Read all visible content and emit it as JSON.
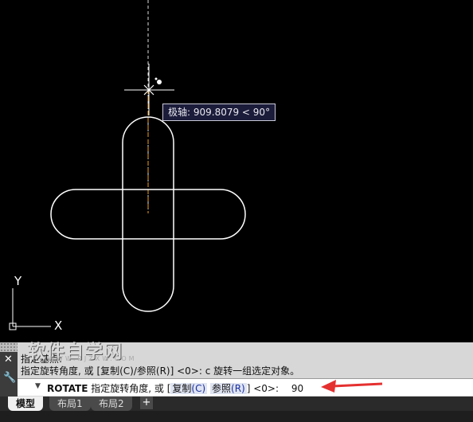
{
  "tooltip": {
    "text": "极轴: 909.8079 < 90°"
  },
  "ucs": {
    "y_label": "Y",
    "x_label": "X"
  },
  "watermark": {
    "text": "软件自学网",
    "sub": "WWW.RJZXW.COM"
  },
  "command_history": [
    "指定基点:",
    "指定旋转角度, 或 [复制(C)/参照(R)] <0>:  c 旋转一组选定对象。"
  ],
  "command_line": {
    "command": "ROTATE",
    "prompt": "指定旋转角度, 或 [",
    "option1_label": "复制",
    "option1_key": "(C)",
    "option2_label": "参照",
    "option2_key": "(R)",
    "tail": "] <0>:",
    "value": "90"
  },
  "tabs": [
    {
      "label": "模型",
      "active": true
    },
    {
      "label": "布局1",
      "active": false
    },
    {
      "label": "布局2",
      "active": false
    }
  ],
  "tab_add_label": "+",
  "colors": {
    "canvas": "#000000",
    "geometry": "#ffffff",
    "polar_track": "#f0a020",
    "annotation_arrow": "#e53030"
  }
}
